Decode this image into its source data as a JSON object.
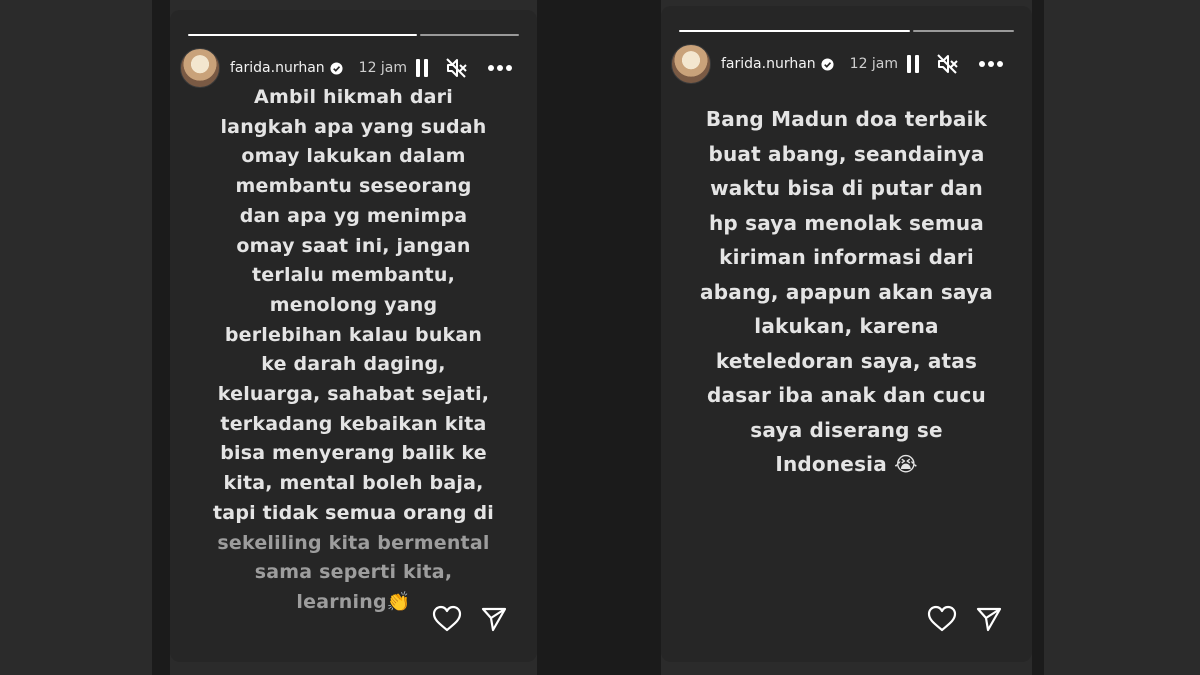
{
  "stories": [
    {
      "username": "farida.nurhan",
      "time": "12 jam",
      "lines": [
        "Ambil hikmah dari",
        "langkah apa yang sudah",
        "omay lakukan dalam",
        "membantu seseorang",
        "dan apa yg menimpa",
        "omay saat ini, jangan",
        "terlalu membantu,",
        "menolong yang",
        "berlebihan kalau bukan",
        "ke darah daging,",
        "keluarga, sahabat sejati,",
        "terkadang kebaikan kita",
        "bisa menyerang balik ke",
        "kita, mental boleh baja,",
        "tapi tidak semua orang di",
        "sekeliling kita bermental",
        "sama seperti kita,",
        "learning👏"
      ]
    },
    {
      "username": "farida.nurhan",
      "time": "12 jam",
      "lines": [
        "Bang Madun doa terbaik",
        "buat abang, seandainya",
        "waktu bisa di putar dan",
        "hp saya menolak semua",
        "kiriman informasi dari",
        "abang, apapun akan saya",
        "lakukan, karena",
        "keteledoran saya, atas",
        "dasar iba anak dan cucu",
        "saya diserang se",
        "Indonesia 😭"
      ]
    }
  ],
  "icons": [
    "verified-badge-icon",
    "pause-icon",
    "mute-icon",
    "more-icon",
    "heart-icon",
    "send-icon"
  ]
}
